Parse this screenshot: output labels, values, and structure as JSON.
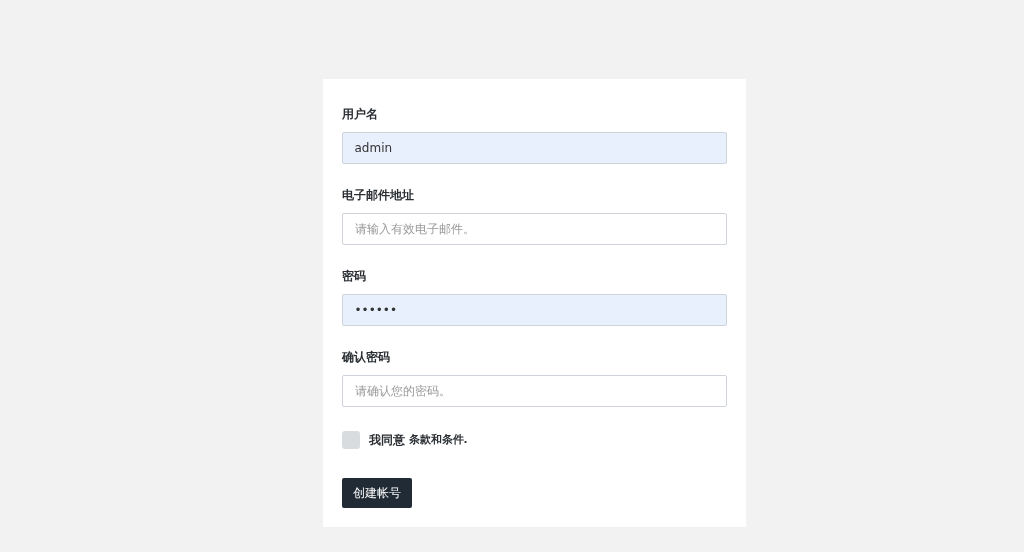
{
  "fields": [
    {
      "label": "用户名",
      "value": "admin",
      "autofilled": true
    },
    {
      "label": "电子邮件地址",
      "placeholder": "请输入有效电子邮件。",
      "autofilled": false
    },
    {
      "label": "密码",
      "value": "••••••",
      "autofilled": true
    },
    {
      "label": "确认密码",
      "placeholder": "请确认您的密码。",
      "autofilled": false
    }
  ],
  "agree": {
    "label": "我同意",
    "link": "条款和条件.",
    "checked": false
  },
  "submit_button": "创建帐号"
}
